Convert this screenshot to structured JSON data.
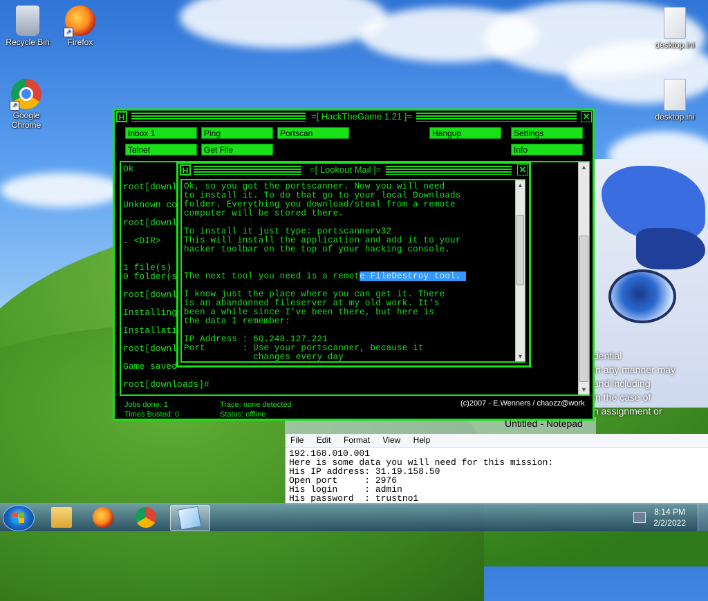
{
  "desktop": {
    "icons": [
      {
        "label": "Recycle Bin"
      },
      {
        "label": "Firefox"
      },
      {
        "label": "Google Chrome"
      },
      {
        "label": "desktop.ini"
      },
      {
        "label": "desktop.ini"
      }
    ],
    "wallpaper_text": "dential\nin any manner may\nand including\nin the case of\nn assignment or"
  },
  "hackthegame": {
    "title": "=[ HackTheGame 1.21 ]=",
    "close_glyph": "✕",
    "toolbar": [
      "Inbox 1",
      "Ping",
      "Portscan",
      "Hangup",
      "Settings",
      "Telnet",
      "Get File",
      "Info"
    ],
    "console_lines": [
      "Ok",
      "root[downl",
      "Unknown co",
      "root[downl",
      ". <DIR>",
      "1 file(s)",
      "0 folder(s",
      "root[downl",
      "Installing",
      "Installati",
      "root[downl",
      "Game saved",
      "root[downloads]#"
    ],
    "status": {
      "jobs_done": "Jobs done: 1",
      "times_busted": "Times Busted: 0",
      "trace": "Trace: none detected",
      "status": "Status: offline",
      "credit": "(c)2007 - E.Wenners / chaozz@work"
    }
  },
  "mail": {
    "title": "=[ Lookout Mail ]=",
    "close_glyph": "✕",
    "lines": [
      "Ok, so you got the portscanner. Now you will need",
      "to install it. To do that go to your local Downloads",
      "folder. Everything you download/steal from a remote",
      "computer will be stored there.",
      "To install it just type: portscannerv32",
      "This will install the application and add it to your",
      "hacker toolbar on the top of your hacking console.",
      "I know just the place where you can get it. There",
      "is an abandonned fileserver at my old work. It's",
      "been a while since I've been there, but here is",
      "the data I remember:",
      "IP Address : 60.248.127.221",
      "Port       : Use your portscanner, because it",
      "             changes every day"
    ],
    "highlight_prefix": "The next tool you need is a remot",
    "highlight_selected": "e FileDestroy tool. "
  },
  "notepad": {
    "title": "Untitled - Notepad",
    "menu": [
      "File",
      "Edit",
      "Format",
      "View",
      "Help"
    ],
    "text": "192.168.010.001\nHere is some data you will need for this mission:\nHis IP address: 31.19.158.50\nOpen port     : 2976\nHis login     : admin\nHis password  : trustno1"
  },
  "taskbar": {
    "time": "8:14 PM",
    "date": "2/2/2022",
    "pinned": [
      "start-button",
      "file-explorer",
      "firefox",
      "chrome",
      "notepad"
    ]
  },
  "colors": {
    "terminal_green": "#19e119",
    "selection": "#3399ff"
  }
}
